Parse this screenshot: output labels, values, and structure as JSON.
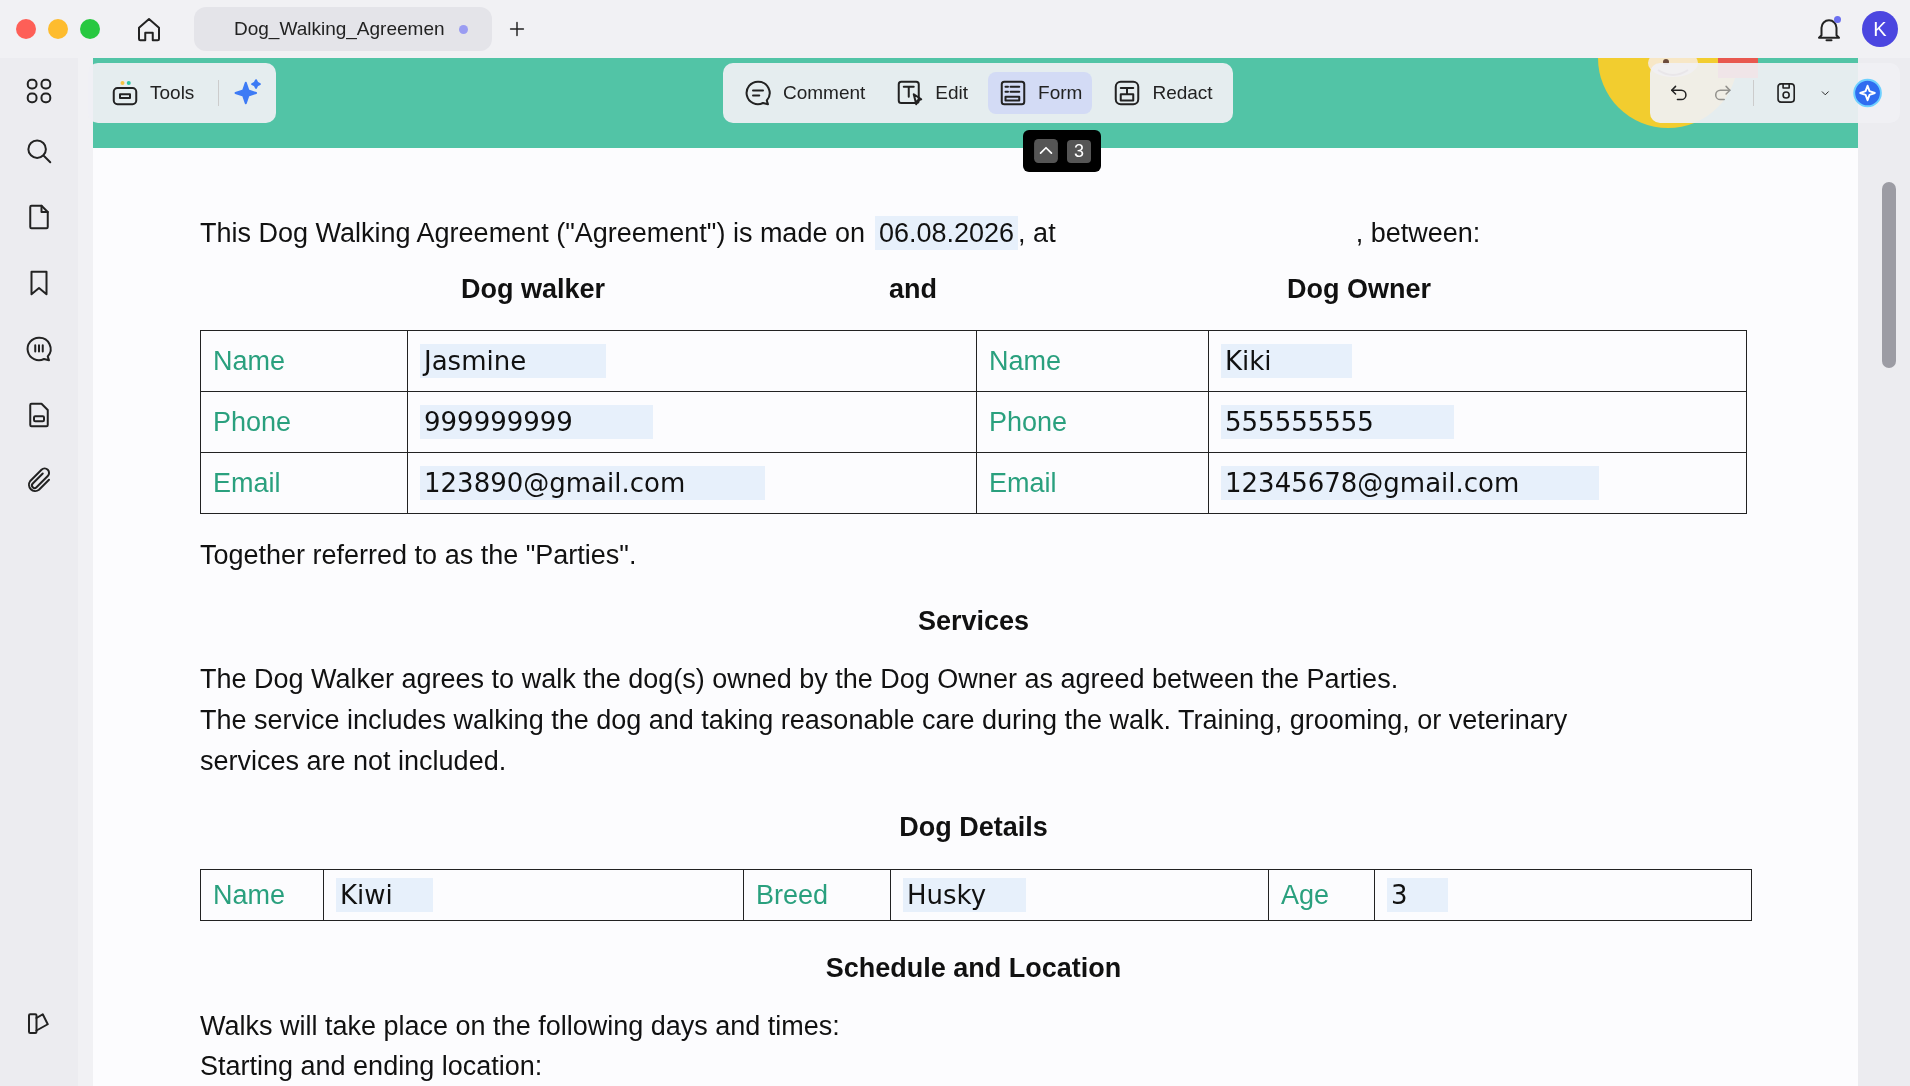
{
  "window": {
    "tab_title": "Dog_Walking_Agreemen",
    "tab_unsaved": true,
    "notification": true,
    "avatar": "K"
  },
  "sidebar": {
    "items": [
      {
        "kind": "search"
      },
      {
        "kind": "page"
      },
      {
        "kind": "bookmark"
      },
      {
        "kind": "comment"
      },
      {
        "kind": "form"
      },
      {
        "kind": "attachment"
      }
    ]
  },
  "tools_panel": {
    "label": "Tools"
  },
  "mode_toolbar": [
    {
      "kind": "comment",
      "label": "Comment",
      "selected": false
    },
    {
      "kind": "edit",
      "label": "Edit",
      "selected": false
    },
    {
      "kind": "form",
      "label": "Form",
      "selected": true
    },
    {
      "kind": "redact",
      "label": "Redact",
      "selected": false
    }
  ],
  "shortcut_tooltip": {
    "keys": [
      "3"
    ]
  },
  "document": {
    "intro": {
      "before": "This Dog Walking Agreement (\"Agreement\") is made on",
      "date": "06.08.2026",
      "after_date": ", at",
      "end": ", between:"
    },
    "party_headings": [
      "Dog walker",
      "and",
      "Dog Owner"
    ],
    "parties_table": [
      [
        {
          "kind": "label",
          "text": "Name"
        },
        {
          "kind": "field",
          "text": "Jasmine"
        },
        {
          "kind": "label",
          "text": "Name"
        },
        {
          "kind": "field",
          "text": "Kiki"
        }
      ],
      [
        {
          "kind": "label",
          "text": "Phone"
        },
        {
          "kind": "field",
          "text": "999999999"
        },
        {
          "kind": "label",
          "text": "Phone"
        },
        {
          "kind": "field",
          "text": "555555555"
        }
      ],
      [
        {
          "kind": "label",
          "text": "Email"
        },
        {
          "kind": "field",
          "text": "123890@gmail.com"
        },
        {
          "kind": "label",
          "text": "Email"
        },
        {
          "kind": "field",
          "text": "12345678@gmail.com"
        }
      ]
    ],
    "parties_note": "Together referred to as the \"Parties\".",
    "services_heading": "Services",
    "services_paragraphs": [
      "The Dog Walker agrees to walk the dog(s) owned by the Dog Owner as agreed between the Parties.",
      "The service includes walking the dog and taking reasonable care during the walk. Training, grooming, or veterinary services are not included."
    ],
    "dog_heading": "Dog Details",
    "dog_table": [
      {
        "kind": "label",
        "text": "Name"
      },
      {
        "kind": "field",
        "text": "Kiwi"
      },
      {
        "kind": "label",
        "text": "Breed"
      },
      {
        "kind": "field",
        "text": "Husky"
      },
      {
        "kind": "label",
        "text": "Age"
      },
      {
        "kind": "field",
        "text": "3"
      }
    ],
    "schedule_heading": "Schedule and Location",
    "schedule_lines": [
      "Walks will take place on the following days and times:",
      "Starting and ending location:"
    ]
  }
}
